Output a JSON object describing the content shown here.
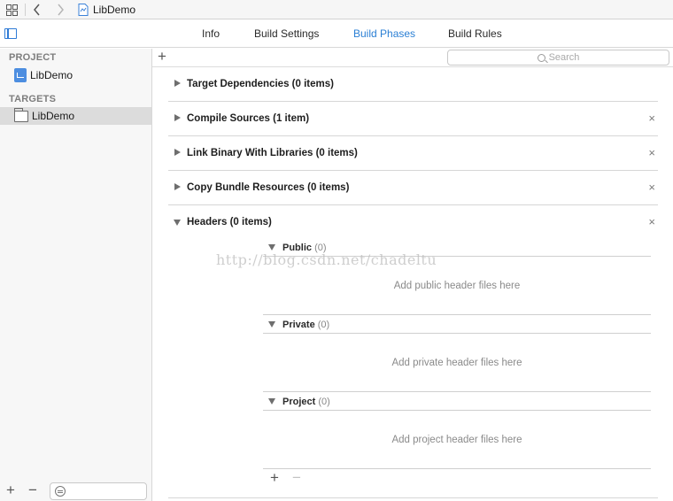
{
  "jumpbar": {
    "crumb_label": "LibDemo",
    "grid_icon": "grid-icon",
    "back_icon": "chevron-left-icon",
    "forward_icon": "chevron-right-icon"
  },
  "tabs": {
    "info": "Info",
    "build_settings": "Build Settings",
    "build_phases": "Build Phases",
    "build_rules": "Build Rules",
    "active": "Build Phases",
    "accent_color": "#2a7fd4"
  },
  "sidebar": {
    "project_header": "PROJECT",
    "project_item": "LibDemo",
    "targets_header": "TARGETS",
    "target_item": "LibDemo",
    "add_label": "+",
    "remove_label": "−"
  },
  "editor": {
    "add_label": "+",
    "search_placeholder": "Search",
    "phases": [
      {
        "title": "Target Dependencies (0 items)",
        "expanded": false,
        "closable": false
      },
      {
        "title": "Compile Sources (1 item)",
        "expanded": false,
        "closable": true
      },
      {
        "title": "Link Binary With Libraries (0 items)",
        "expanded": false,
        "closable": true
      },
      {
        "title": "Copy Bundle Resources (0 items)",
        "expanded": false,
        "closable": true
      },
      {
        "title": "Headers (0 items)",
        "expanded": true,
        "closable": true
      }
    ],
    "close_glyph": "×",
    "headers": {
      "sections": [
        {
          "label": "Public",
          "count": "(0)",
          "empty_text": "Add public header files here"
        },
        {
          "label": "Private",
          "count": "(0)",
          "empty_text": "Add private header files here"
        },
        {
          "label": "Project",
          "count": "(0)",
          "empty_text": "Add project header files here"
        }
      ],
      "add_label": "+",
      "remove_label": "−"
    }
  },
  "watermark": "http://blog.csdn.net/chadeltu"
}
